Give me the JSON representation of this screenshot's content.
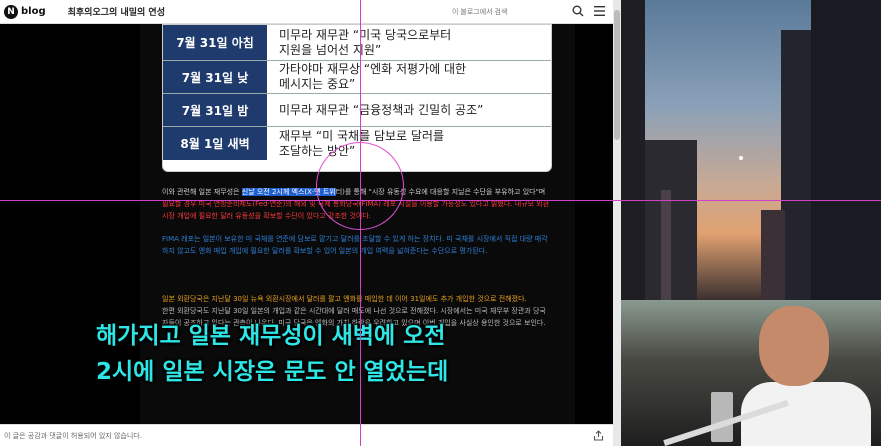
{
  "header": {
    "logo_letter": "N",
    "logo_text": "blog",
    "blog_title": "최후의오그의 내밀의 연성",
    "search_placeholder": "이 블로그에서 검색"
  },
  "table": {
    "rows": [
      {
        "date": "7월 31일 아침",
        "text": "미무라 재무관 “미국 당국으로부터\n지원을 넘어선 지원”"
      },
      {
        "date": "7월 31일 낮",
        "text": "가타야마 재무상 “엔화 저평가에 대한\n메시지는 중요”"
      },
      {
        "date": "7월 31일 밤",
        "text": "미무라 재무관 “금융정책과 긴밀히 공조”"
      },
      {
        "date": "8월 1일 새벽",
        "text": "재무부 “미 국채를 담보로 달러를\n조달하는 방안”"
      }
    ]
  },
  "paragraphs": {
    "p1_a": "이와 관련해 일본 재무성은 ",
    "p1_hl": "신날 오전 2시께 엑스(X·옛 트위",
    "p1_b": "터)를 통해 \"시장 유동성 수요에 대응할 지닐은 수단을 ",
    "p1_c": "부유하고 있다\"며 ",
    "p1_red": "필요할 경우 미국 연방준비제도(Fed·연준)의 해외 및 국제 통화당국(FIMA) 레포 시설을 이용할 가능성도 있다고 밝혔다. 내규모 외환시장 개입에 필요한 달러 유동성을 확보할 수단이 있다고 강조한 것이다.",
    "p2": "FIMA 레포는 일본이 보유한 미 국채를 연준에 담보로 맡기고 달러를 조달할 수 있게 하는 장치다. 미 국채를 시장에서 직접 대량 매각하지 않고도 엔화 매입 개입에 필요한 달러를 확보할 수 있어 일본의 개입 여력을 넓혀준다는 수단으로 평가된다.",
    "p3": "일본 외환당국은 지난달 30일 뉴욕 외환시장에서 달러를 팔고 엔화를 매입한 데 이어 31일에도 추가 개입한 것으로 전해졌다.",
    "p4": "한편 외환당국도 지난달 30일 일본의 개입과 같은 시간대에 달러 매도에 나선 것으로 전해졌다. 시장에서는 미국 재무부 장관과 당국자들이 공조하고 있다는 관측이 나온다. 미국 당국은 엔화의 가치 하락을 우려하고 있으며 이번 개입을 사실상 용인한 것으로 보인다."
  },
  "subtitles": {
    "line1": "해가지고 일본 재무성이 새벽에 오전",
    "line2": "2시에 일본 시장은 문도 안 열었는데"
  },
  "footer": {
    "text": "이 글은 공감과 댓글이 허용되어 있지 않습니다."
  },
  "colors": {
    "table_date_bg": "#1f3b6e",
    "subtitle": "#2ee6e6",
    "highlight": "#1f5fcf",
    "red_text": "#ff3b3b",
    "blue_text": "#2f7fd6",
    "orange_text": "#e8a020"
  }
}
